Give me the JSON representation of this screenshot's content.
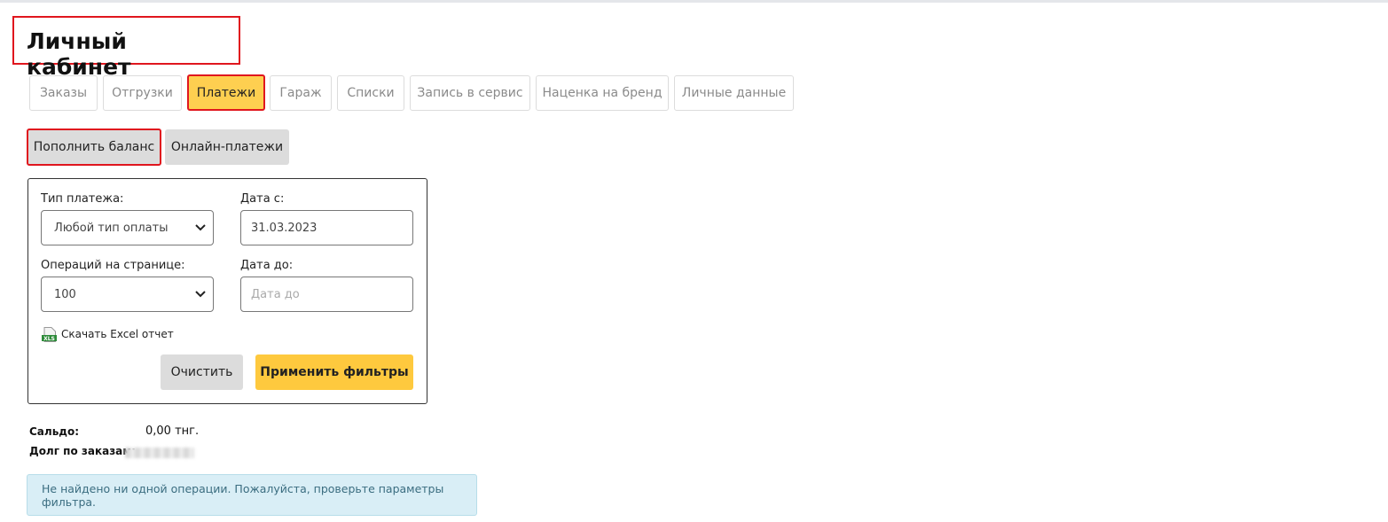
{
  "page": {
    "title": "Личный кабинет"
  },
  "tabs": [
    {
      "label": "Заказы",
      "active": false
    },
    {
      "label": "Отгрузки",
      "active": false
    },
    {
      "label": "Платежи",
      "active": true
    },
    {
      "label": "Гараж",
      "active": false
    },
    {
      "label": "Списки",
      "active": false
    },
    {
      "label": "Запись в сервис",
      "active": false
    },
    {
      "label": "Наценка на бренд",
      "active": false
    },
    {
      "label": "Личные данные",
      "active": false
    }
  ],
  "actions": {
    "topup_label": "Пополнить баланс",
    "online_label": "Онлайн-платежи"
  },
  "filters": {
    "payment_type_label": "Тип платежа:",
    "payment_type_value": "Любой тип оплаты",
    "date_from_label": "Дата с:",
    "date_from_value": "31.03.2023",
    "per_page_label": "Операций на странице:",
    "per_page_value": "100",
    "date_to_label": "Дата до:",
    "date_to_placeholder": "Дата до",
    "excel_label": "Скачать Excel отчет",
    "excel_icon_text": "XLS",
    "clear_label": "Очистить",
    "apply_label": "Применить фильтры"
  },
  "summary": {
    "saldo_label": "Сальдо:",
    "saldo_value": "0,00 тнг.",
    "debt_label": "Долг по заказам:"
  },
  "alert": {
    "text": "Не найдено ни одной операции. Пожалуйста, проверьте параметры фильтра."
  },
  "colors": {
    "accent": "#fecf50",
    "apply": "#fec93e",
    "highlight": "#e0161e",
    "alert_bg": "#d9eef6",
    "excel_green": "#2e8b3a"
  }
}
